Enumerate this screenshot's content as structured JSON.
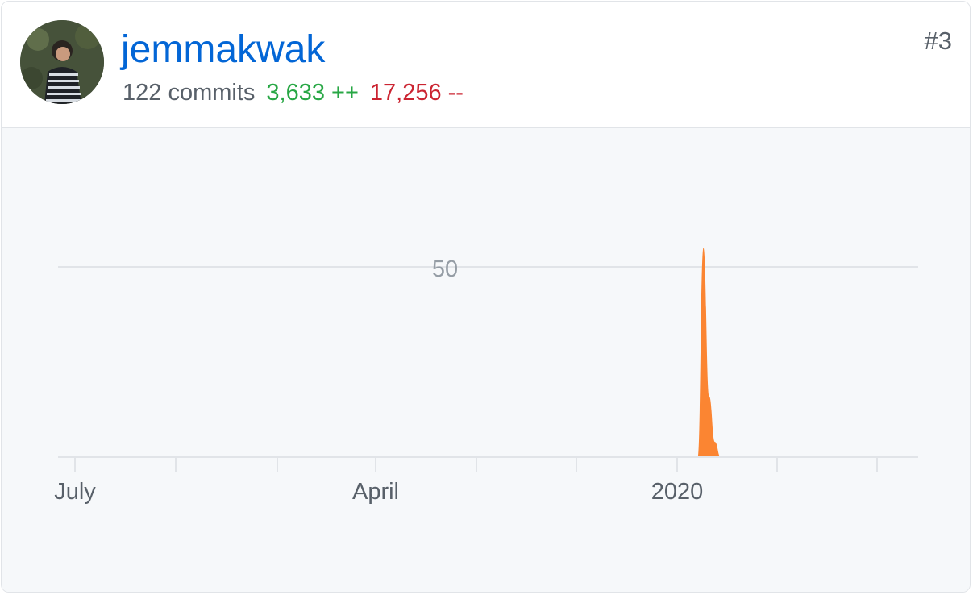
{
  "contributor": {
    "username": "jemmakwak",
    "commits": "122 commits",
    "additions": "3,633 ++",
    "deletions": "17,256 --",
    "rank": "#3",
    "avatar_icon": "user-avatar-photo"
  },
  "colors": {
    "link": "#0366d6",
    "additions": "#28a745",
    "deletions": "#cb2431",
    "area_fill": "#fb8532",
    "grid": "#e1e4e8"
  },
  "chart_data": {
    "type": "area",
    "title": "",
    "xlabel": "",
    "ylabel": "",
    "y_ticks": [
      "50"
    ],
    "x_tick_labels": [
      "July",
      "April",
      "2020"
    ],
    "ylim": [
      0,
      56
    ],
    "grid": true,
    "series": [
      {
        "values": [
          {
            "x": "2020-01-26",
            "y": 0
          },
          {
            "x": "2020-02-02",
            "y": 55
          },
          {
            "x": "2020-02-09",
            "y": 16
          },
          {
            "x": "2020-02-16",
            "y": 4
          },
          {
            "x": "2020-02-23",
            "y": 0
          }
        ]
      }
    ]
  }
}
